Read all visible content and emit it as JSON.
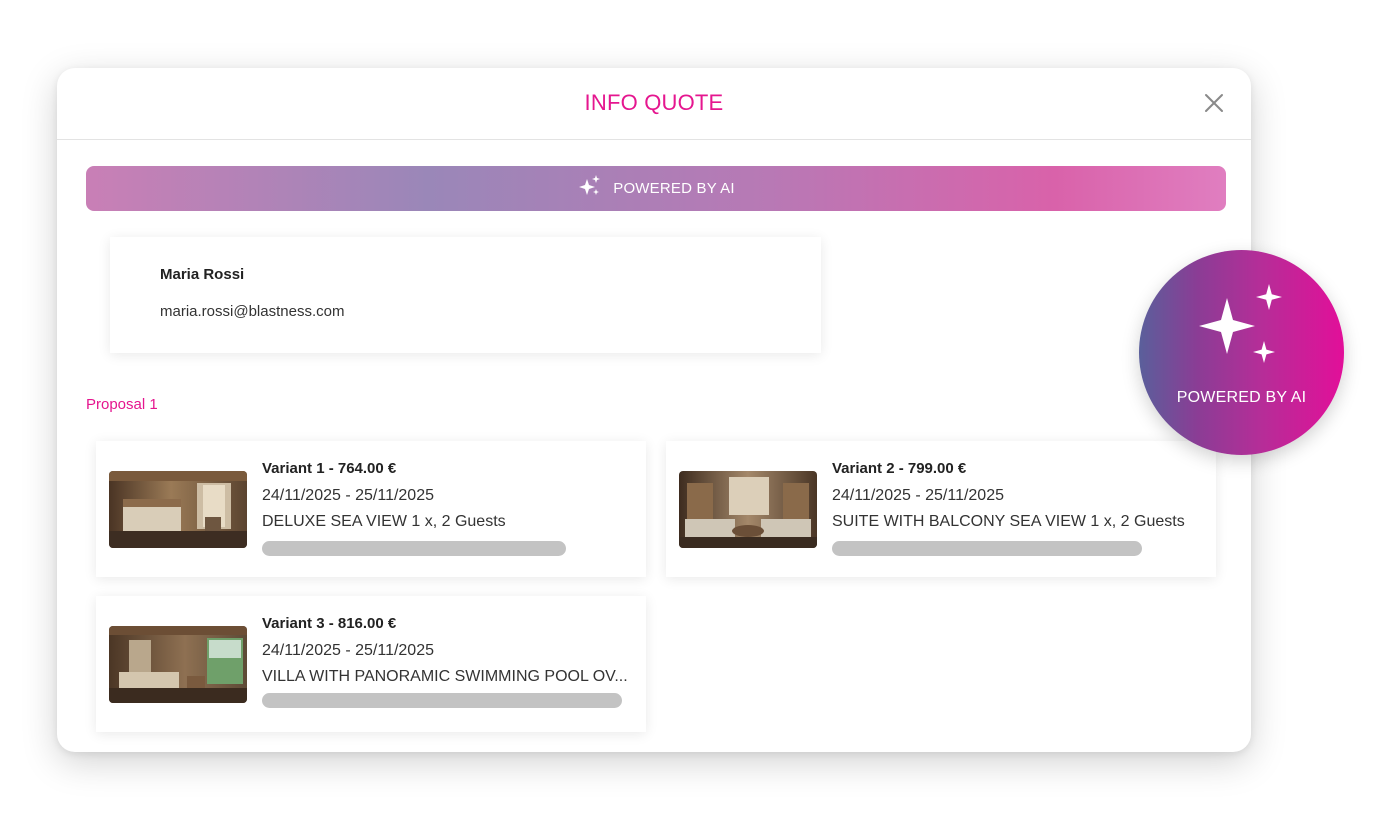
{
  "modal": {
    "title": "INFO QUOTE",
    "close_icon": "close-icon"
  },
  "ai_banner": {
    "icon": "sparkles-icon",
    "label": "POWERED BY AI"
  },
  "contact": {
    "name": "Maria Rossi",
    "email": "maria.rossi@blastness.com"
  },
  "proposal": {
    "label": "Proposal 1",
    "variants": [
      {
        "title": "Variant 1 - 764.00 €",
        "dates": "24/11/2025 - 25/11/2025",
        "room": "DELUXE SEA VIEW 1 x, 2 Guests",
        "image": "hotel-room-photo"
      },
      {
        "title": "Variant 2 - 799.00 €",
        "dates": "24/11/2025 - 25/11/2025",
        "room": "SUITE WITH BALCONY SEA VIEW 1 x, 2 Guests",
        "image": "hotel-suite-photo"
      },
      {
        "title": "Variant 3 - 816.00 €",
        "dates": "24/11/2025 - 25/11/2025",
        "room": "VILLA WITH PANORAMIC SWIMMING POOL OV...",
        "image": "hotel-villa-photo"
      }
    ]
  },
  "ai_badge": {
    "icon": "sparkles-icon",
    "label": "POWERED BY AI"
  },
  "colors": {
    "accent": "#e5168f",
    "placeholder_bar": "#c3c3c3"
  }
}
